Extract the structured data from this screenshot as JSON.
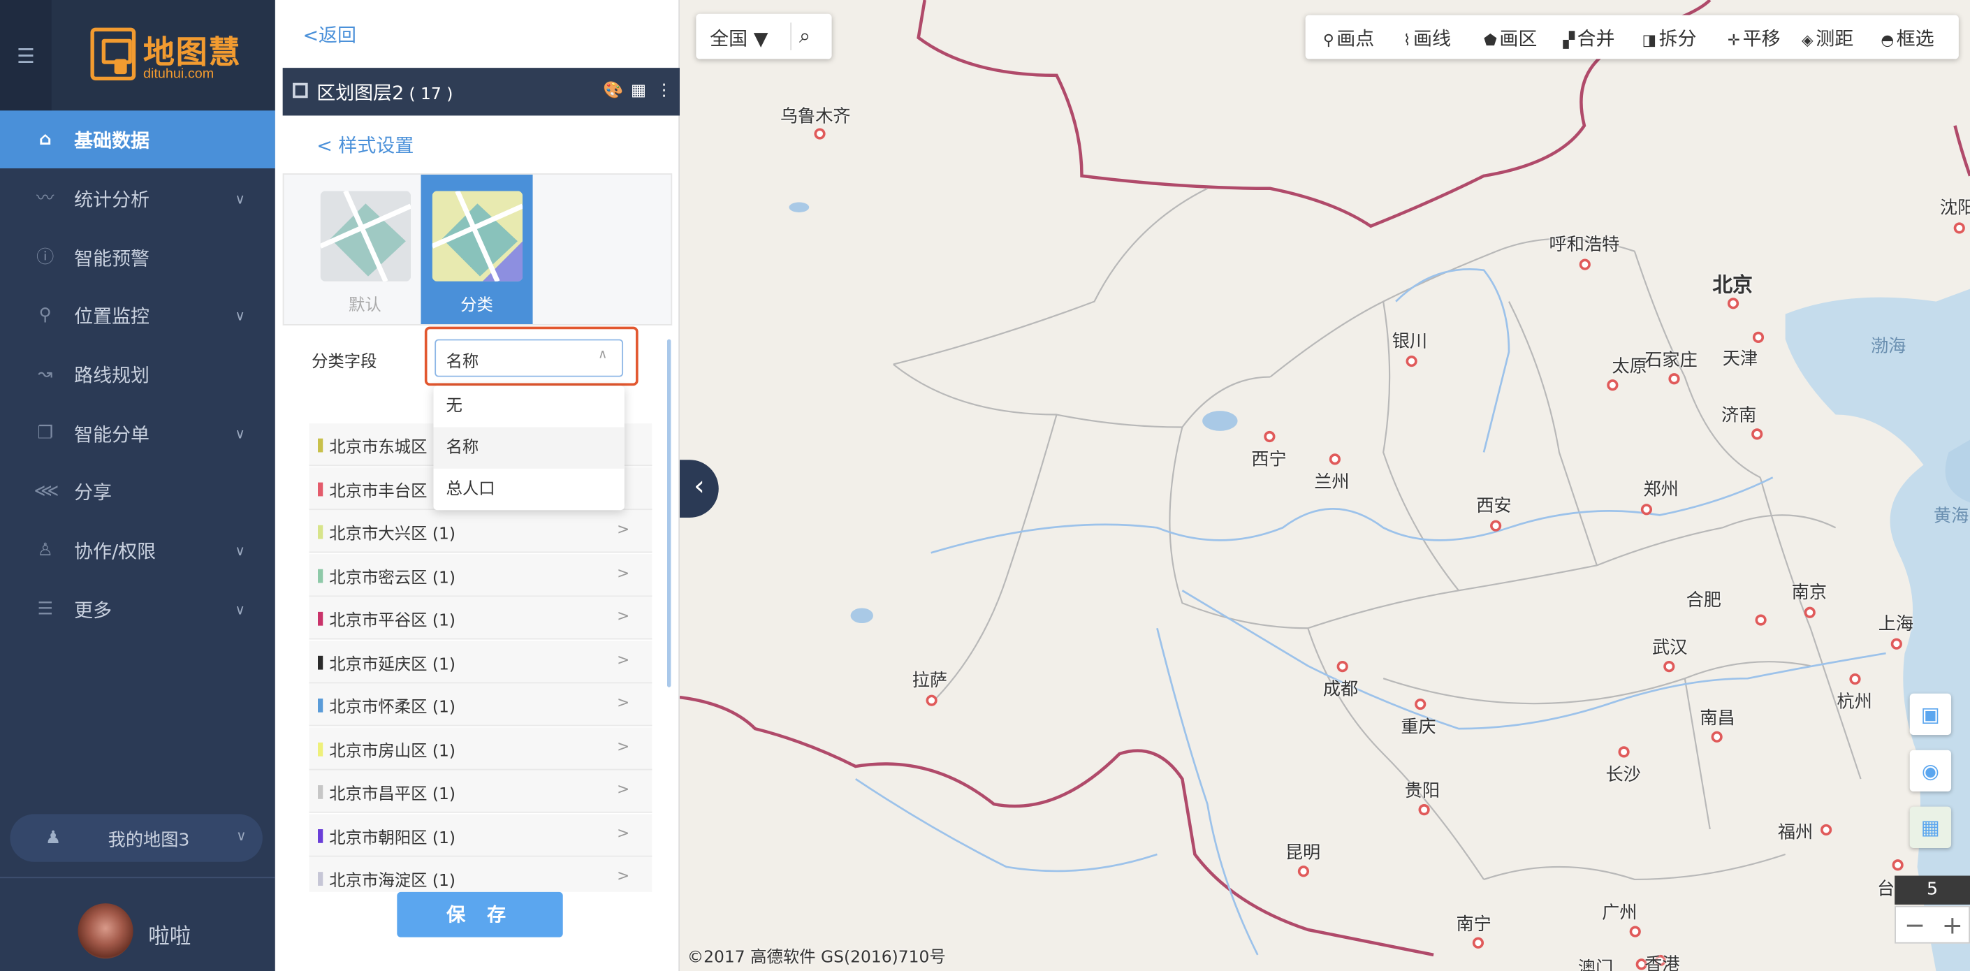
{
  "sidebar": {
    "collapse_icon": "menu-collapse-icon",
    "logo_text": "地图慧",
    "logo_sub": "dituhui.com",
    "items": [
      {
        "label": "基础数据",
        "icon": "home-icon",
        "active": true
      },
      {
        "label": "统计分析",
        "icon": "chart-line-icon",
        "chevron": true
      },
      {
        "label": "智能预警",
        "icon": "info-icon"
      },
      {
        "label": "位置监控",
        "icon": "location-pin-icon",
        "chevron": true
      },
      {
        "label": "路线规划",
        "icon": "route-icon"
      },
      {
        "label": "智能分单",
        "icon": "copy-icon",
        "chevron": true
      },
      {
        "label": "分享",
        "icon": "share-icon"
      },
      {
        "label": "协作/权限",
        "icon": "user-icon",
        "chevron": true
      },
      {
        "label": "更多",
        "icon": "list-icon",
        "chevron": true
      }
    ],
    "my_map": "我的地图3",
    "username": "啦啦"
  },
  "panel": {
    "back": "<返回",
    "layer_title": "区划图层2",
    "layer_count": "( 17 )",
    "style_link": "< 样式设置",
    "style_options": [
      {
        "label": "默认",
        "selected": false
      },
      {
        "label": "分类",
        "selected": true
      }
    ],
    "field_label": "分类字段",
    "select_value": "名称",
    "dropdown_options": [
      "无",
      "名称",
      "总人口"
    ],
    "rows": [
      {
        "label": "北京市东城区",
        "count": "",
        "color": "#c8c04a"
      },
      {
        "label": "北京市丰台区",
        "count": "",
        "color": "#e35b6b"
      },
      {
        "label": "北京市大兴区 (1)",
        "count": ">",
        "color": "#d7e48a"
      },
      {
        "label": "北京市密云区 (1)",
        "count": ">",
        "color": "#8ec9a8"
      },
      {
        "label": "北京市平谷区 (1)",
        "count": ">",
        "color": "#c9336a"
      },
      {
        "label": "北京市延庆区 (1)",
        "count": ">",
        "color": "#2a2a2a"
      },
      {
        "label": "北京市怀柔区 (1)",
        "count": ">",
        "color": "#5a9bd8"
      },
      {
        "label": "北京市房山区 (1)",
        "count": ">",
        "color": "#eef07a"
      },
      {
        "label": "北京市昌平区 (1)",
        "count": ">",
        "color": "#c6c6c6"
      },
      {
        "label": "北京市朝阳区 (1)",
        "count": ">",
        "color": "#6a3ed8"
      },
      {
        "label": "北京市海淀区 (1)",
        "count": ">",
        "color": "#c6c6d6"
      }
    ],
    "save": "保 存"
  },
  "map": {
    "region": "全国",
    "toolbar": [
      {
        "label": "画点",
        "icon": "pin-icon"
      },
      {
        "label": "画线",
        "icon": "polyline-icon"
      },
      {
        "label": "画区",
        "icon": "polygon-icon"
      },
      {
        "label": "合并",
        "icon": "merge-icon"
      },
      {
        "label": "拆分",
        "icon": "split-icon"
      },
      {
        "label": "平移",
        "icon": "move-icon"
      },
      {
        "label": "测距",
        "icon": "ruler-icon"
      },
      {
        "label": "框选",
        "icon": "lasso-icon"
      }
    ],
    "cities": [
      {
        "name": "乌鲁木齐"
      },
      {
        "name": "呼和浩特"
      },
      {
        "name": "北京"
      },
      {
        "name": "沈阳"
      },
      {
        "name": "银川"
      },
      {
        "name": "太原"
      },
      {
        "name": "石家庄"
      },
      {
        "name": "天津"
      },
      {
        "name": "济南"
      },
      {
        "name": "西宁"
      },
      {
        "name": "兰州"
      },
      {
        "name": "郑州"
      },
      {
        "name": "西安"
      },
      {
        "name": "合肥"
      },
      {
        "name": "南京"
      },
      {
        "name": "上海"
      },
      {
        "name": "武汉"
      },
      {
        "name": "拉萨"
      },
      {
        "name": "成都"
      },
      {
        "name": "重庆"
      },
      {
        "name": "杭州"
      },
      {
        "name": "南昌"
      },
      {
        "name": "长沙"
      },
      {
        "name": "贵阳"
      },
      {
        "name": "福州"
      },
      {
        "name": "昆明"
      },
      {
        "name": "南宁"
      },
      {
        "name": "广州"
      },
      {
        "name": "澳门"
      },
      {
        "name": "香港"
      },
      {
        "name": "台"
      }
    ],
    "seas": [
      "渤海",
      "黄海"
    ],
    "zoom": "5",
    "zoom_out": "−",
    "zoom_in": "+",
    "copyright": "©2017 高德软件 GS(2016)710号"
  }
}
